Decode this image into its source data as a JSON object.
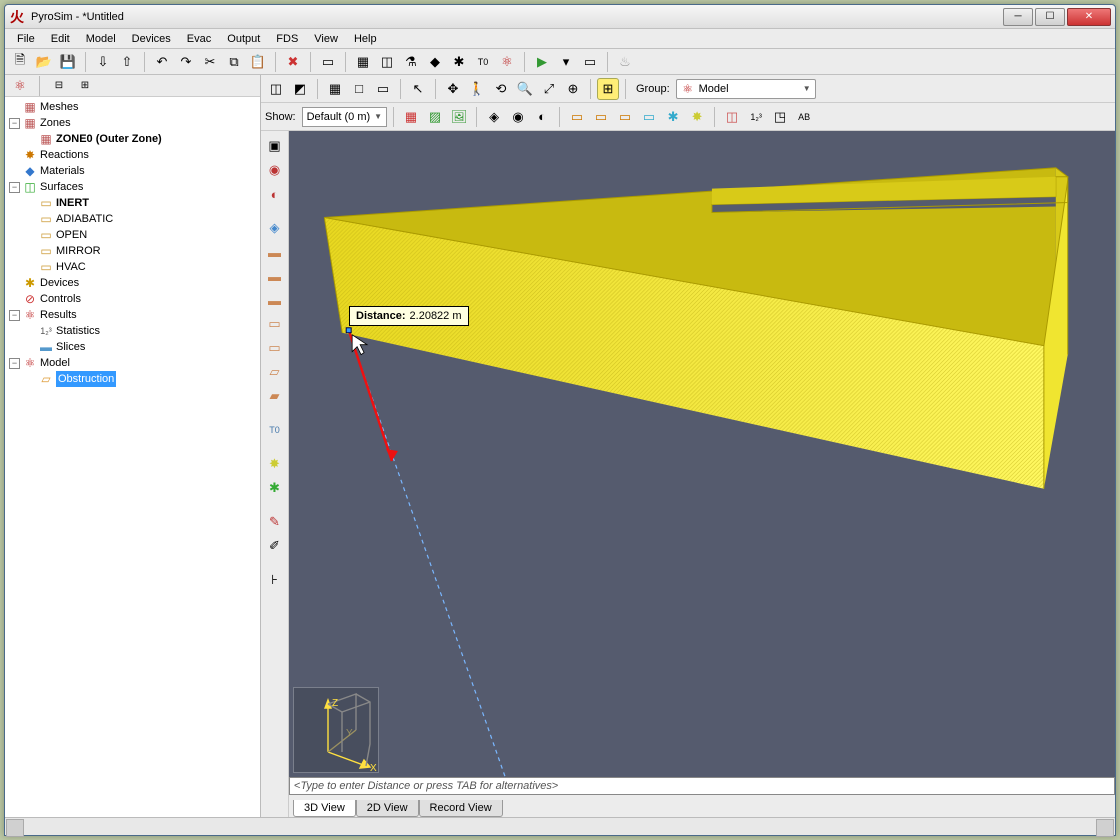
{
  "window": {
    "title": "PyroSim - *Untitled"
  },
  "menubar": [
    "File",
    "Edit",
    "Model",
    "Devices",
    "Evac",
    "Output",
    "FDS",
    "View",
    "Help"
  ],
  "toolbar_main": [
    {
      "name": "new-icon",
      "sym": "🗎"
    },
    {
      "name": "open-icon",
      "sym": "📂"
    },
    {
      "name": "save-icon",
      "sym": "💾"
    },
    {
      "name": "sep"
    },
    {
      "name": "import-icon",
      "sym": "⇩"
    },
    {
      "name": "export-icon",
      "sym": "⇧"
    },
    {
      "name": "sep"
    },
    {
      "name": "undo-icon",
      "sym": "↶"
    },
    {
      "name": "redo-icon",
      "sym": "↷"
    },
    {
      "name": "cut-icon",
      "sym": "✂"
    },
    {
      "name": "copy-icon",
      "sym": "⧉"
    },
    {
      "name": "paste-icon",
      "sym": "📋"
    },
    {
      "name": "sep"
    },
    {
      "name": "delete-icon",
      "sym": "✖",
      "color": "#c33"
    },
    {
      "name": "sep"
    },
    {
      "name": "props-icon",
      "sym": "▭"
    },
    {
      "name": "sep"
    },
    {
      "name": "mesh-icon",
      "sym": "▦"
    },
    {
      "name": "surface-icon",
      "sym": "◫"
    },
    {
      "name": "reaction-icon",
      "sym": "⚗"
    },
    {
      "name": "material-icon",
      "sym": "◆"
    },
    {
      "name": "device-icon",
      "sym": "✱"
    },
    {
      "name": "text-icon",
      "sym": "T0",
      "fs": "9px"
    },
    {
      "name": "model-icon",
      "sym": "⚛",
      "color": "#b22"
    },
    {
      "name": "sep"
    },
    {
      "name": "run-icon",
      "sym": "▶",
      "color": "#393"
    },
    {
      "name": "dropdown-icon",
      "sym": "▾"
    },
    {
      "name": "run2-icon",
      "sym": "▭"
    },
    {
      "name": "sep"
    },
    {
      "name": "fire-icon",
      "sym": "♨",
      "color": "#999"
    }
  ],
  "sidebar": {
    "modes": [
      {
        "name": "tree-mode-icon",
        "sym": "⚛"
      },
      {
        "name": "collapse-icon",
        "sym": "⊟"
      },
      {
        "name": "expand-icon",
        "sym": "⊞"
      }
    ],
    "tree": {
      "meshes": "Meshes",
      "zones": "Zones",
      "zone0": "ZONE0 (Outer Zone)",
      "reactions": "Reactions",
      "materials": "Materials",
      "surfaces": "Surfaces",
      "inert": "INERT",
      "adiabatic": "ADIABATIC",
      "open": "OPEN",
      "mirror": "MIRROR",
      "hvac": "HVAC",
      "devices": "Devices",
      "controls": "Controls",
      "results": "Results",
      "statistics": "Statistics",
      "slices": "Slices",
      "model": "Model",
      "obstruction": "Obstruction"
    }
  },
  "view_toolbar1": {
    "group_label": "Group:",
    "group_value": "Model"
  },
  "view_toolbar2": {
    "show_label": "Show:",
    "show_value": "Default (0 m)"
  },
  "tooltip": {
    "label": "Distance:",
    "value": "2.20822 m"
  },
  "axis": {
    "x": "X",
    "y": "Y",
    "z": "Z"
  },
  "status_prompt": "<Type to enter Distance or press TAB for alternatives>",
  "tabs": [
    "3D View",
    "2D View",
    "Record View"
  ],
  "active_tab": 0
}
